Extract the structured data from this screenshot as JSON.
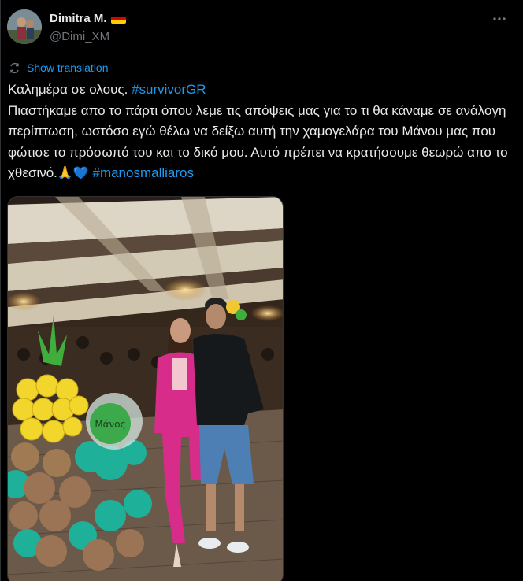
{
  "author": {
    "display_name": "Dimitra M.",
    "handle": "@Dimi_XM",
    "flag": "germany-flag"
  },
  "translation": {
    "label": "Show translation"
  },
  "tweet": {
    "line1_text": "Καλημέρα σε ολους. ",
    "line1_hashtag": "#survivorGR",
    "body": "Πιαστήκαμε απο το πάρτι όπου λεμε τις απόψεις μας για το τι θα κάναμε σε ανάλογη περίπτωση, ωστόσο εγώ θέλω να δείξω αυτή την χαμογελάρα του Μάνου μας που φώτισε το πρόσωπό του και το δικό μου. Αυτό πρέπει να κρατήσουμε θεωρώ απο το χθεσινό.",
    "emoji_pray": "🙏",
    "emoji_heart": "💙",
    "end_hashtag": "#manosmalliaros"
  },
  "media": {
    "balloon_label": "Μάνος"
  },
  "colors": {
    "background": "#000000",
    "text": "#e7e9ea",
    "secondary": "#71767b",
    "accent": "#1d9bf0",
    "border": "#2f3336"
  }
}
